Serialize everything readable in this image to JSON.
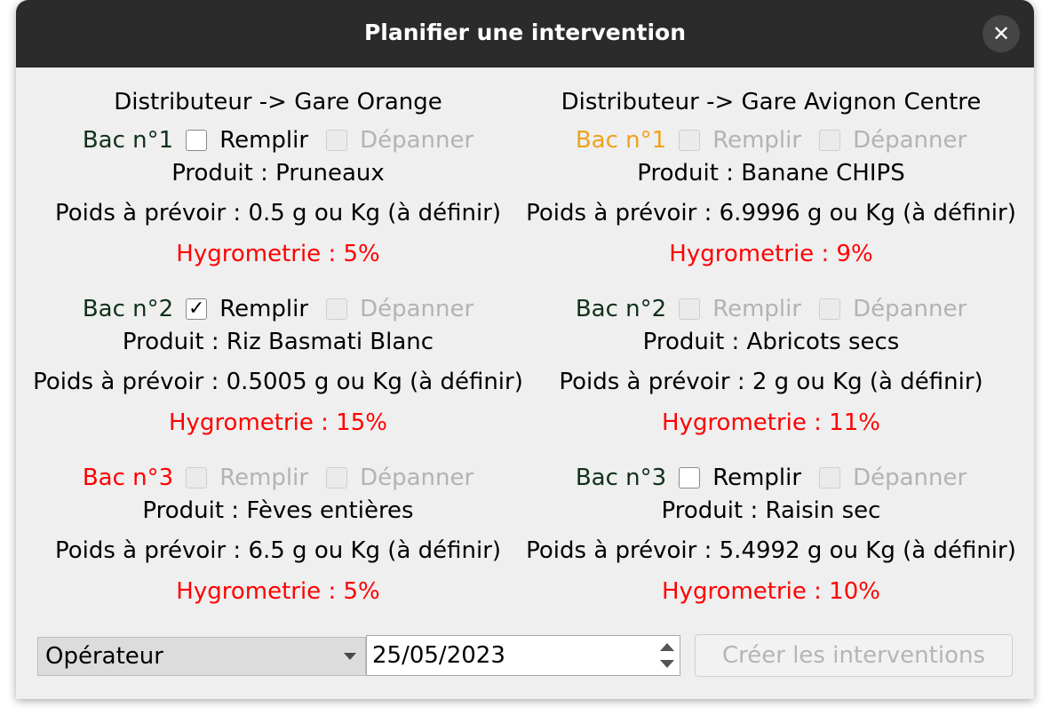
{
  "window": {
    "title": "Planifier une intervention"
  },
  "colors": {
    "titlebar": "#2b2b2b",
    "bac_ok": "#10301a",
    "bac_warning": "#f0a21c",
    "bac_critical": "#ff0000",
    "hygrometrie": "#ff0000",
    "disabled_text": "#b3b3b3"
  },
  "distributors": [
    {
      "heading": "Distributeur -> Gare Orange",
      "bacs": [
        {
          "label": "Bac n°1",
          "status": "ok",
          "remplir": {
            "label": "Remplir",
            "checked": false,
            "enabled": true
          },
          "depanner": {
            "label": "Dépanner",
            "checked": false,
            "enabled": false
          },
          "produit": "Produit : Pruneaux",
          "poids": "Poids à prévoir : 0.5 g ou Kg (à définir)",
          "hygrometrie": "Hygrometrie : 5%"
        },
        {
          "label": "Bac n°2",
          "status": "ok",
          "remplir": {
            "label": "Remplir",
            "checked": true,
            "enabled": true
          },
          "depanner": {
            "label": "Dépanner",
            "checked": false,
            "enabled": false
          },
          "produit": "Produit : Riz Basmati Blanc",
          "poids": "Poids à prévoir : 0.5005 g ou Kg (à définir)",
          "hygrometrie": "Hygrometrie : 15%"
        },
        {
          "label": "Bac n°3",
          "status": "critical",
          "remplir": {
            "label": "Remplir",
            "checked": false,
            "enabled": false
          },
          "depanner": {
            "label": "Dépanner",
            "checked": false,
            "enabled": false
          },
          "produit": "Produit : Fèves entières",
          "poids": "Poids à prévoir : 6.5 g ou Kg (à définir)",
          "hygrometrie": "Hygrometrie : 5%"
        }
      ]
    },
    {
      "heading": "Distributeur -> Gare Avignon Centre",
      "bacs": [
        {
          "label": "Bac n°1",
          "status": "warning",
          "remplir": {
            "label": "Remplir",
            "checked": false,
            "enabled": false
          },
          "depanner": {
            "label": "Dépanner",
            "checked": false,
            "enabled": false
          },
          "produit": "Produit : Banane CHIPS",
          "poids": "Poids à prévoir : 6.9996 g ou Kg (à définir)",
          "hygrometrie": "Hygrometrie : 9%"
        },
        {
          "label": "Bac n°2",
          "status": "ok",
          "remplir": {
            "label": "Remplir",
            "checked": false,
            "enabled": false
          },
          "depanner": {
            "label": "Dépanner",
            "checked": false,
            "enabled": false
          },
          "produit": "Produit : Abricots secs",
          "poids": "Poids à prévoir : 2 g ou Kg (à définir)",
          "hygrometrie": "Hygrometrie : 11%"
        },
        {
          "label": "Bac n°3",
          "status": "ok",
          "remplir": {
            "label": "Remplir",
            "checked": false,
            "enabled": true
          },
          "depanner": {
            "label": "Dépanner",
            "checked": false,
            "enabled": false
          },
          "produit": "Produit : Raisin sec",
          "poids": "Poids à prévoir : 5.4992 g ou Kg (à définir)",
          "hygrometrie": "Hygrometrie : 10%"
        }
      ]
    }
  ],
  "footer": {
    "operator_select": "Opérateur",
    "date": "25/05/2023",
    "create_label": "Créer les interventions"
  }
}
